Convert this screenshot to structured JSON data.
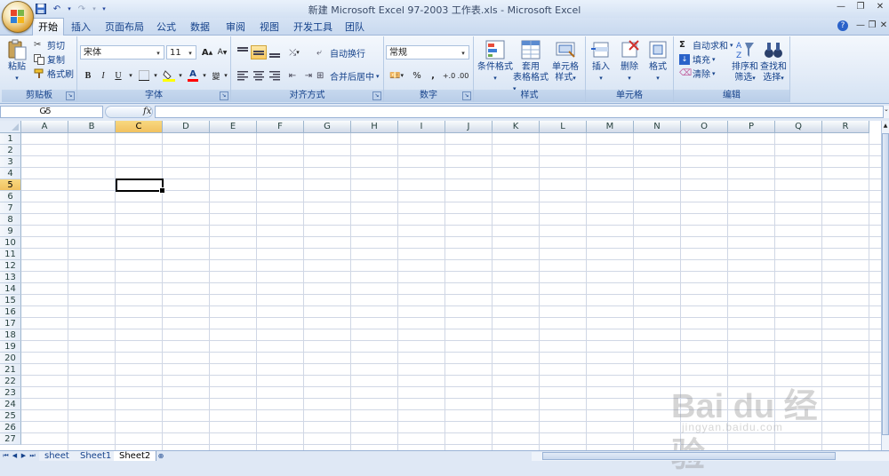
{
  "window": {
    "title": "新建 Microsoft Excel 97-2003 工作表.xls - Microsoft Excel",
    "controls": [
      "minimize-icon",
      "restore-icon",
      "close-icon"
    ]
  },
  "ribbon_tabs": [
    "开始",
    "插入",
    "页面布局",
    "公式",
    "数据",
    "审阅",
    "视图",
    "开发工具",
    "团队"
  ],
  "active_tab": "开始",
  "clipboard": {
    "label": "剪贴板",
    "paste": "粘贴",
    "cut": "剪切",
    "copy": "复制",
    "format_painter": "格式刷"
  },
  "font": {
    "label": "字体",
    "name": "宋体",
    "size": "11",
    "grow": "A",
    "shrink": "A",
    "bold": "B",
    "italic": "I",
    "underline": "U",
    "font_color_glyph": "A",
    "phonetic_glyph": "變"
  },
  "alignment": {
    "label": "对齐方式",
    "wrap_text": "自动换行",
    "merge_center": "合并后居中"
  },
  "number": {
    "label": "数字",
    "format": "常规",
    "percent": "%",
    "comma": ",",
    "inc_decimal": "+.0",
    "dec_decimal": ".00"
  },
  "styles": {
    "label": "样式",
    "conditional": "条件格式",
    "table_format_1": "套用",
    "table_format_2": "表格格式",
    "cell_styles_1": "单元格",
    "cell_styles_2": "样式"
  },
  "cells": {
    "label": "单元格",
    "insert": "插入",
    "delete": "删除",
    "format": "格式"
  },
  "editing": {
    "label": "编辑",
    "autosum": "自动求和",
    "fill": "填充",
    "clear": "清除",
    "sort_1": "排序和",
    "sort_2": "筛选",
    "find_1": "查找和",
    "find_2": "选择"
  },
  "formula_bar": {
    "name_box": "C5",
    "fx": "fx",
    "content": ""
  },
  "grid": {
    "columns": [
      "A",
      "B",
      "C",
      "D",
      "E",
      "F",
      "G",
      "H",
      "I",
      "J",
      "K",
      "L",
      "M",
      "N",
      "O",
      "P",
      "Q",
      "R"
    ],
    "rows": [
      "1",
      "2",
      "3",
      "4",
      "5",
      "6",
      "7",
      "8",
      "9",
      "10",
      "11",
      "12",
      "13",
      "14",
      "15",
      "16",
      "17",
      "18",
      "19",
      "20",
      "21",
      "22",
      "23",
      "24",
      "25",
      "26",
      "27"
    ],
    "selected_column": "C",
    "selected_row": "5"
  },
  "sheets": [
    "sheet",
    "Sheet1",
    "Sheet2"
  ],
  "active_sheet": "Sheet2",
  "watermark": {
    "main": "Bai du 经验",
    "sub": "jingyan.baidu.com"
  },
  "colors": {
    "ribbon_bg": "#dfe8f5",
    "selected_header": "#f8d880",
    "group_text": "#15428b",
    "gridline": "#d0d7e5"
  }
}
